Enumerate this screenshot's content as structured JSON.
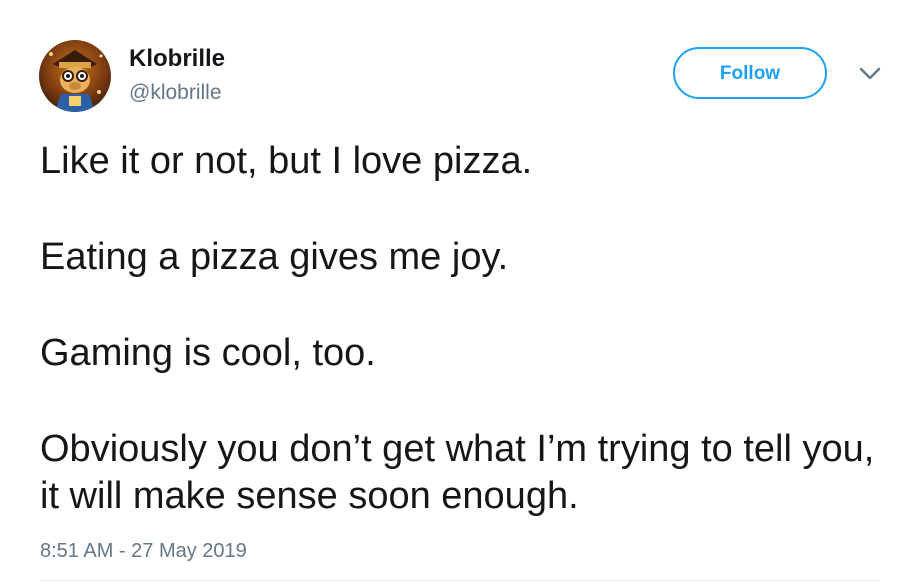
{
  "user": {
    "display_name": "Klobrille",
    "handle": "@klobrille",
    "avatar_icon": "avatar-image"
  },
  "actions": {
    "follow_label": "Follow",
    "menu_icon": "chevron-down-icon"
  },
  "tweet": {
    "paragraphs": [
      "Like it or not, but I love pizza.",
      "Eating a pizza gives me joy.",
      "Gaming is cool, too.",
      "Obviously you don’t get what I’m trying to tell you, it will make sense soon enough."
    ],
    "timestamp": "8:51 AM - 27 May 2019"
  },
  "colors": {
    "accent": "#1da1f2",
    "text": "#14171a",
    "secondary": "#657786",
    "divider": "#e6ecf0"
  }
}
